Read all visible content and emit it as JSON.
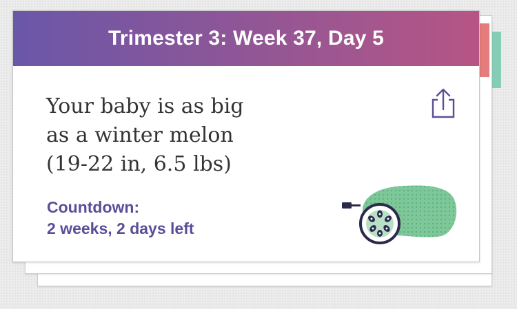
{
  "colors": {
    "header_gradient_start": "#6a57a8",
    "header_gradient_end": "#b65585",
    "accent": "#5b4d98",
    "tab_red": "#e57c7c",
    "tab_teal": "#86cdb6",
    "melon_green": "#7ec799",
    "outline": "#2c2a4c"
  },
  "card": {
    "header": "Trimester 3: Week 37, Day 5",
    "headline_lines": [
      "Your baby is as big",
      "as a winter melon",
      "(19-22 in, 6.5 lbs)"
    ],
    "countdown_label": "Countdown:",
    "countdown_value": "2 weeks, 2 days left",
    "share_icon": "share-icon",
    "illustration_icon": "winter-melon-icon"
  }
}
